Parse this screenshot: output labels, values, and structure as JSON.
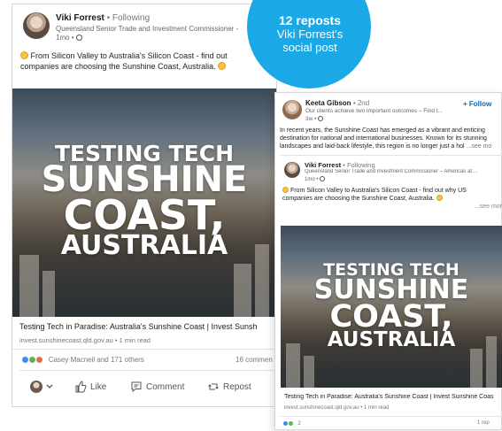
{
  "badge": {
    "line1": "12 reposts",
    "line2": "Viki Forrest's",
    "line3": "social post"
  },
  "post_a": {
    "author": "Viki Forrest",
    "following": "• Following",
    "role": "Queensland Senior Trade and Investment Commissioner -",
    "time": "1mo •",
    "text_line1": "From Silicon Valley to Australia's Silicon Coast - find out",
    "text_line2": "companies are choosing the Sunshine Coast, Australia.",
    "hero": {
      "line1": "TESTING TECH",
      "line2": "SUNSHINE",
      "line3": "COAST,",
      "line4": "AUSTRALIA"
    },
    "link_title": "Testing Tech in Paradise: Australia's Sunshine Coast | Invest Sunsh",
    "link_meta": "invest.sunshinecoast.qld.gov.au • 1 min read",
    "reactions_text": "Casey Macneil and 171 others",
    "comments_count": "16 commen",
    "actions": {
      "like": "Like",
      "comment": "Comment",
      "repost": "Repost"
    }
  },
  "post_b": {
    "author": "Keeta Gibson",
    "degree": "• 2nd",
    "tagline": "Our clients achieve two important outcomes – Find t...",
    "time": "3w •",
    "follow_label": "+ Follow",
    "text_line1": "In recent years, the Sunshine Coast has emerged as a vibrant and enticing",
    "text_line2": "destination for national and international businesses. Known for its stunning",
    "text_line3": "landscapes and laid-back lifestyle, this region is no longer just a hol",
    "see_more": "...see mo",
    "inner": {
      "author": "Viki Forrest",
      "following": "• Following",
      "role": "Queensland Senior Trade and Investment Commissioner – Americas at ...",
      "time": "1mo •",
      "text_line1": "From Silicon Valley to Australia's Silicon Coast - find out why US",
      "text_line2": "companies are choosing the Sunshine Coast, Australia.",
      "see_more": "...see mor"
    },
    "hero": {
      "line1": "TESTING TECH",
      "line2": "SUNSHINE",
      "line3": "COAST,",
      "line4": "AUSTRALIA"
    },
    "link_title": "Testing Tech in Paradise: Australia's Sunshine Coast | Invest Sunshine Coas",
    "link_meta": "invest.sunshinecoast.qld.gov.au • 1 min read",
    "reactions_count": "2",
    "reposts_count": "1 rep"
  },
  "colors": {
    "badge": "#1aa8e6",
    "link_blue": "#0a66c2",
    "like": "#378fe9",
    "celebrate": "#6dae4f",
    "love": "#df704d"
  }
}
